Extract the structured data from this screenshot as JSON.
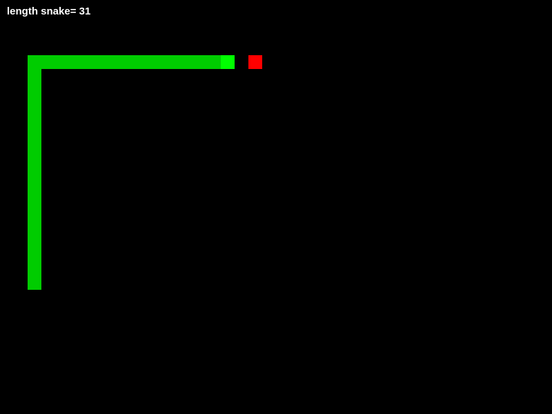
{
  "hud": {
    "score_prefix": "length snake=",
    "length": "31"
  },
  "colors": {
    "background": "#000000",
    "snake_body": "#00cc00",
    "snake_head": "#00ff00",
    "food": "#ff0000",
    "text": "#ffffff"
  },
  "grid": {
    "cols": 40,
    "rows": 30
  },
  "snake": {
    "head": [
      16,
      4
    ],
    "body": [
      [
        15,
        4
      ],
      [
        14,
        4
      ],
      [
        13,
        4
      ],
      [
        12,
        4
      ],
      [
        11,
        4
      ],
      [
        10,
        4
      ],
      [
        9,
        4
      ],
      [
        8,
        4
      ],
      [
        7,
        4
      ],
      [
        6,
        4
      ],
      [
        5,
        4
      ],
      [
        4,
        4
      ],
      [
        3,
        4
      ],
      [
        2,
        4
      ],
      [
        2,
        5
      ],
      [
        2,
        6
      ],
      [
        2,
        7
      ],
      [
        2,
        8
      ],
      [
        2,
        9
      ],
      [
        2,
        10
      ],
      [
        2,
        11
      ],
      [
        2,
        12
      ],
      [
        2,
        13
      ],
      [
        2,
        14
      ],
      [
        2,
        15
      ],
      [
        2,
        16
      ],
      [
        2,
        17
      ],
      [
        2,
        18
      ],
      [
        2,
        19
      ],
      [
        2,
        20
      ]
    ]
  },
  "food": [
    18,
    4
  ]
}
